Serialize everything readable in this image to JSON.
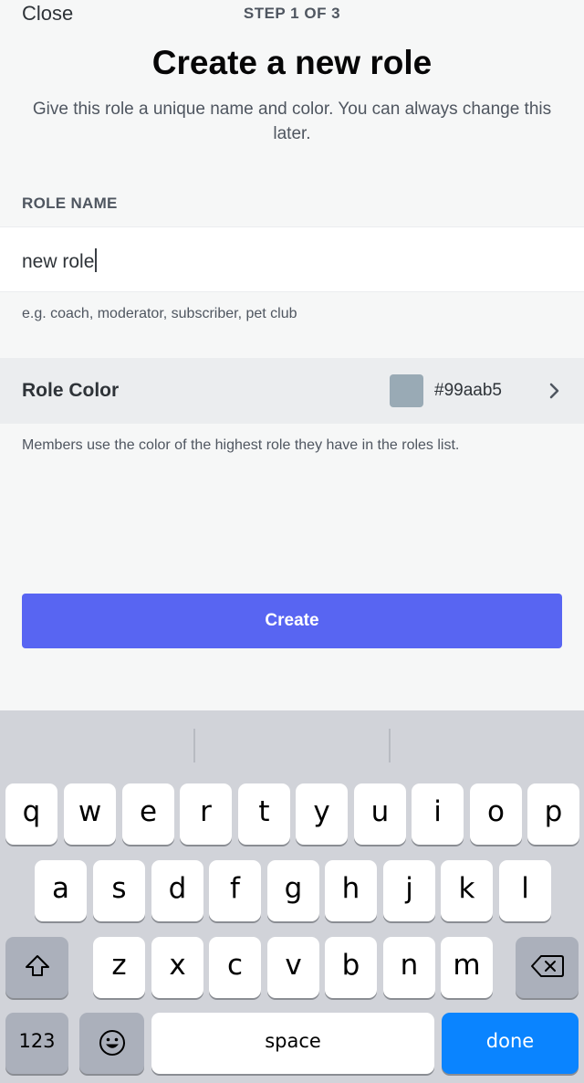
{
  "header": {
    "close_label": "Close",
    "step_label": "STEP 1 OF 3"
  },
  "title": "Create a new role",
  "subtitle": "Give this role a unique name and color. You can always change this later.",
  "role_name": {
    "section_label": "ROLE NAME",
    "value": "new role",
    "hint": "e.g. coach, moderator, subscriber, pet club"
  },
  "role_color": {
    "label": "Role Color",
    "swatch_color": "#99aab5",
    "hex": "#99aab5",
    "hint": "Members use the color of the highest role they have in the roles list."
  },
  "create_label": "Create",
  "colors": {
    "accent": "#5865f2",
    "keyboard_done": "#0a84ff"
  },
  "keyboard": {
    "row1": [
      "q",
      "w",
      "e",
      "r",
      "t",
      "y",
      "u",
      "i",
      "o",
      "p"
    ],
    "row2": [
      "a",
      "s",
      "d",
      "f",
      "g",
      "h",
      "j",
      "k",
      "l"
    ],
    "row3": [
      "z",
      "x",
      "c",
      "v",
      "b",
      "n",
      "m"
    ],
    "shift_icon": "shift-icon",
    "delete_icon": "backspace-icon",
    "numbers_label": "123",
    "emoji_icon": "emoji-icon",
    "space_label": "space",
    "done_label": "done"
  }
}
